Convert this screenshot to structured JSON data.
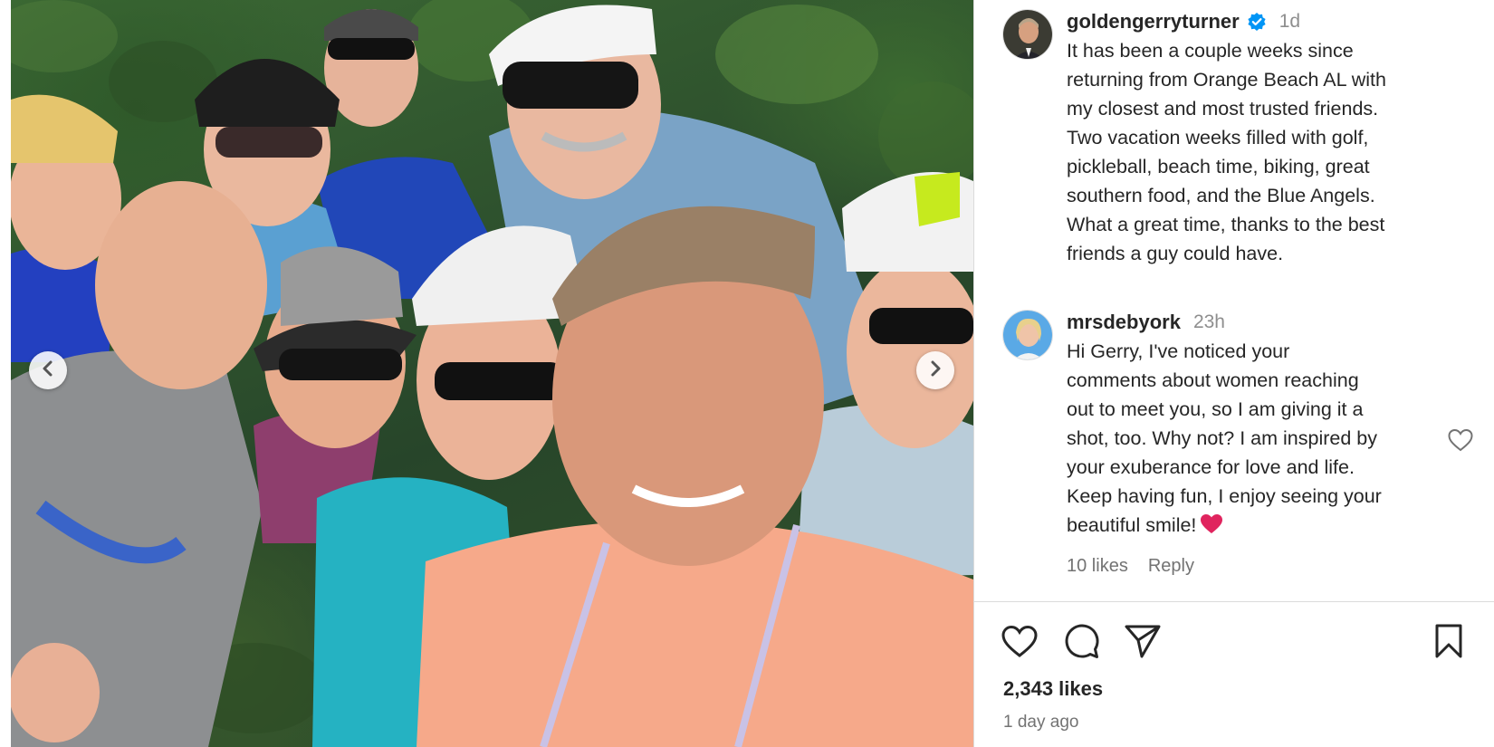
{
  "post": {
    "author": {
      "username": "goldengerryturner",
      "verified": true,
      "time_ago": "1d"
    },
    "caption": "It has been a couple weeks since\nreturning from Orange Beach AL with\nmy closest and most trusted friends.\nTwo vacation weeks filled with golf,\npickleball, beach time, biking, great\nsouthern food, and the Blue Angels.\nWhat a great time, thanks to the best\nfriends a guy could have.",
    "comments": [
      {
        "username": "mrsdebyork",
        "time_ago": "23h",
        "text": "Hi Gerry, I've noticed your\ncomments about women reaching\nout to meet you, so I am giving it a\nshot, too. Why not? I am inspired by\nyour exuberance for love and life.\nKeep having fun, I enjoy seeing your\nbeautiful smile!",
        "emoji": "red-heart",
        "likes_label": "10 likes",
        "reply_label": "Reply"
      }
    ],
    "likes_total": "2,343 likes",
    "date_label": "1 day ago"
  },
  "icons": {
    "carousel_prev": "chevron-left-icon",
    "carousel_next": "chevron-right-icon",
    "verified": "verified-badge-icon",
    "comment_like": "heart-outline-icon",
    "like": "heart-outline-icon",
    "comment": "speech-bubble-icon",
    "share": "paper-plane-icon",
    "save": "bookmark-icon"
  },
  "colors": {
    "verified_blue": "#0095f6",
    "text_primary": "#262626",
    "text_secondary": "#8e8e8e",
    "heart_red": "#e0245e"
  }
}
